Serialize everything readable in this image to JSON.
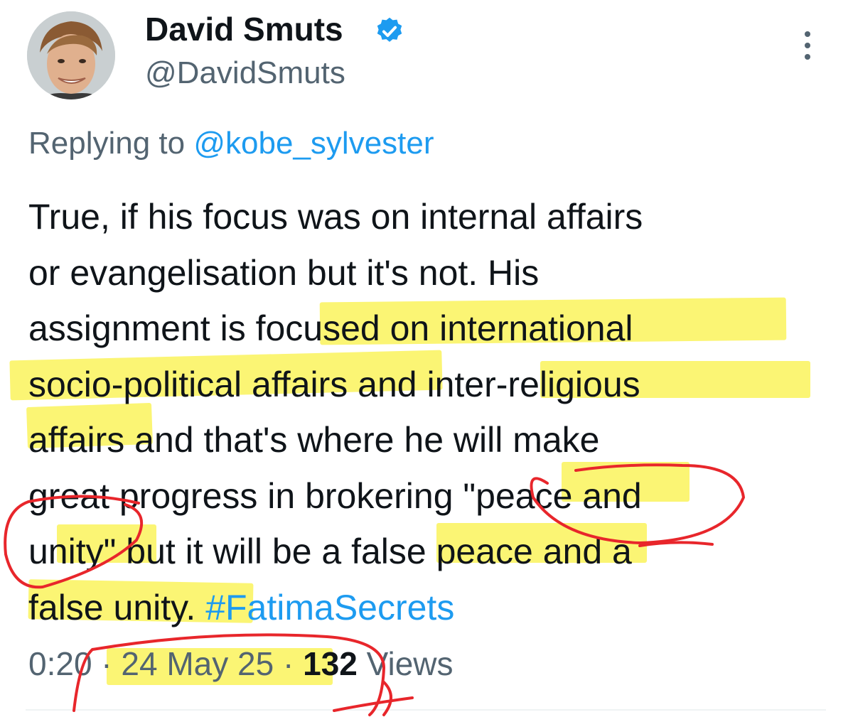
{
  "author": {
    "display_name": "David Smuts",
    "handle": "@DavidSmuts",
    "verified_icon": "verified-badge-icon",
    "avatar_icon": "avatar-photo"
  },
  "reply": {
    "prefix": "Replying to",
    "mention": "@kobe_sylvester"
  },
  "tweet": {
    "lines": [
      [
        "True, if his focus was on internal affairs"
      ],
      [
        "or evangelisation but it's not. His"
      ],
      [
        "assignment is f",
        "ocused on international"
      ],
      [
        "socio-political affairs",
        " and ",
        "inter-religious"
      ],
      [
        "affairs",
        " and that's where he will make"
      ],
      [
        "great progress in brokering \"peace and"
      ],
      [
        "unity\"",
        " but it will be a ",
        "false peace",
        " and a"
      ],
      [
        "false unity. ",
        "#FatimaSecrets"
      ]
    ]
  },
  "meta": {
    "time": "0:20",
    "sep1": " · ",
    "date": "24 May 25",
    "sep2": " · ",
    "views_count": "132",
    "views_label": " Views"
  },
  "colors": {
    "link": "#1d9bf0",
    "secondary_text": "#536471",
    "highlight": "#faf35c",
    "annotation_red": "#e8262b"
  }
}
